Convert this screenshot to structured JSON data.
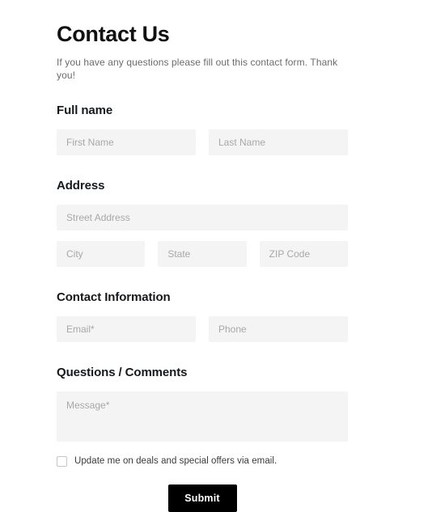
{
  "header": {
    "title": "Contact Us",
    "subtitle": "If you have any questions please fill out this contact form. Thank you!"
  },
  "sections": {
    "full_name": {
      "heading": "Full name",
      "first_name_placeholder": "First Name",
      "last_name_placeholder": "Last Name",
      "first_name_value": "",
      "last_name_value": ""
    },
    "address": {
      "heading": "Address",
      "street_placeholder": "Street Address",
      "city_placeholder": "City",
      "state_placeholder": "State",
      "zip_placeholder": "ZIP Code",
      "street_value": "",
      "city_value": "",
      "state_value": "",
      "zip_value": ""
    },
    "contact_information": {
      "heading": "Contact Information",
      "email_placeholder": "Email*",
      "phone_placeholder": "Phone",
      "email_value": "",
      "phone_value": ""
    },
    "questions_comments": {
      "heading": "Questions / Comments",
      "message_placeholder": "Message*",
      "message_value": ""
    }
  },
  "optin": {
    "label": "Update me on deals and special offers via email.",
    "checked": false
  },
  "submit": {
    "label": "Submit"
  },
  "colors": {
    "page_background": "#ffffff",
    "field_background": "#f4f4f4",
    "placeholder_text": "#a8a8a8",
    "heading_text": "#16191c",
    "subtitle_text": "#6b6b6b",
    "button_background": "#000000",
    "button_text": "#ffffff",
    "checkbox_border": "#c6c6c6"
  }
}
